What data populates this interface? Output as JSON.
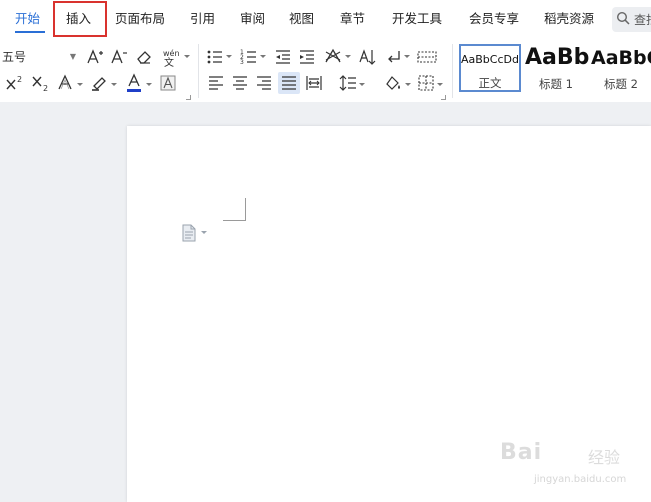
{
  "menubar": {
    "tabs": [
      {
        "label": "开始",
        "active": true
      },
      {
        "label": "插入",
        "highlighted": true
      },
      {
        "label": "页面布局"
      },
      {
        "label": "引用"
      },
      {
        "label": "审阅"
      },
      {
        "label": "视图"
      },
      {
        "label": "章节"
      },
      {
        "label": "开发工具"
      },
      {
        "label": "会员专享"
      },
      {
        "label": "稻壳资源"
      }
    ],
    "search_label": "查找"
  },
  "toolbar": {
    "font_size": "五号",
    "styles": [
      {
        "preview": "AaBbCcDd",
        "label": "正文",
        "selected": true
      },
      {
        "preview": "AaBb",
        "label": "标题 1"
      },
      {
        "preview": "AaBbC",
        "label": "标题 2"
      }
    ]
  },
  "colors": {
    "accent": "#2a6fd6",
    "highlight_border": "#d9322e",
    "font_color_bar": "#1f3fc8",
    "style_selected_border": "#5b8ad0"
  },
  "icons": [
    "grow-font-icon",
    "shrink-font-icon",
    "clear-format-icon",
    "phonetic-guide-icon",
    "superscript-icon",
    "subscript-icon",
    "text-effect-icon",
    "highlight-icon",
    "font-color-icon",
    "character-border-icon",
    "bullet-list-icon",
    "numbered-list-icon",
    "decrease-indent-icon",
    "increase-indent-icon",
    "chinese-layout-icon",
    "sort-icon",
    "show-marks-icon",
    "table-grid-icon",
    "align-left-icon",
    "align-center-icon",
    "align-right-icon",
    "justify-icon",
    "distributed-icon",
    "line-spacing-icon",
    "shading-icon",
    "borders-icon",
    "document-icon",
    "search-icon"
  ],
  "watermark": {
    "brand": "Bai",
    "suffix": "经验",
    "url": "jingyan.baidu.com"
  }
}
